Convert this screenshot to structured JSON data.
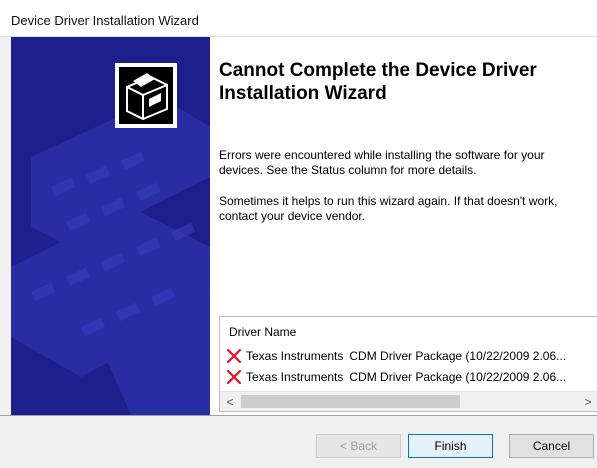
{
  "window": {
    "title": "Device Driver Installation Wizard"
  },
  "main": {
    "heading": "Cannot Complete the Device Driver Installation Wizard",
    "paragraph1": "Errors were encountered while installing the software for your devices. See the Status column for more details.",
    "paragraph2": "Sometimes it helps to run this wizard again. If that doesn't work, contact your device vendor."
  },
  "driver_list": {
    "column_header": "Driver Name",
    "rows": [
      {
        "status_icon": "error-x-icon",
        "vendor": "Texas Instruments",
        "package": "CDM Driver Package (10/22/2009 2.06..."
      },
      {
        "status_icon": "error-x-icon",
        "vendor": "Texas Instruments",
        "package": "CDM Driver Package (10/22/2009 2.06..."
      }
    ],
    "scroll_left": "<",
    "scroll_right": ">"
  },
  "buttons": {
    "back": "< Back",
    "finish": "Finish",
    "cancel": "Cancel"
  },
  "colors": {
    "banner": "#1e1f8c",
    "error": "#e81123",
    "focus": "#0078d7"
  }
}
